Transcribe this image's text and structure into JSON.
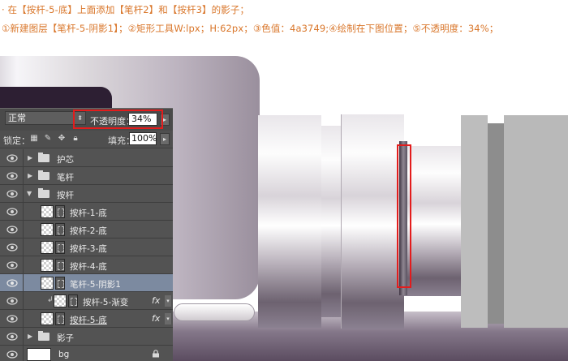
{
  "instructions": {
    "line1": "· 在【按杆-5-底】上面添加【笔杆2】和【按杆3】的影子；",
    "line2": "①新建图层【笔杆-5-阴影1】；②矩形工具W:lpx；H:62px；③色值：4a3749;④绘制在下图位置；⑤不透明度：34%；"
  },
  "colors": {
    "instruction_text": "#d9762a",
    "highlight_box": "#e31c1c",
    "panel_bg": "#535353",
    "selected_layer": "#7c8aa0"
  },
  "layers_panel": {
    "blend_mode": "正常",
    "opacity_label": "不透明度：",
    "opacity_value": "34%",
    "lock_label": "锁定：",
    "fill_label": "填充：",
    "fill_value": "100%",
    "layers": [
      {
        "name": "护芯",
        "type": "group",
        "expanded": false
      },
      {
        "name": "笔杆",
        "type": "group",
        "expanded": false
      },
      {
        "name": "按杆",
        "type": "group",
        "expanded": true
      },
      {
        "name": "按杆-1-底",
        "type": "layer"
      },
      {
        "name": "按杆-2-底",
        "type": "layer"
      },
      {
        "name": "按杆-3-底",
        "type": "layer"
      },
      {
        "name": "按杆-4-底",
        "type": "layer"
      },
      {
        "name": "笔杆-5-阴影1",
        "type": "layer",
        "selected": true
      },
      {
        "name": "按杆-5-渐变",
        "type": "layer",
        "clipped": true,
        "fx": "fx"
      },
      {
        "name": "按杆-5-底",
        "type": "layer",
        "fx": "fx"
      },
      {
        "name": "影子",
        "type": "group",
        "expanded": false
      },
      {
        "name": "bg",
        "type": "background",
        "locked": true
      }
    ]
  }
}
